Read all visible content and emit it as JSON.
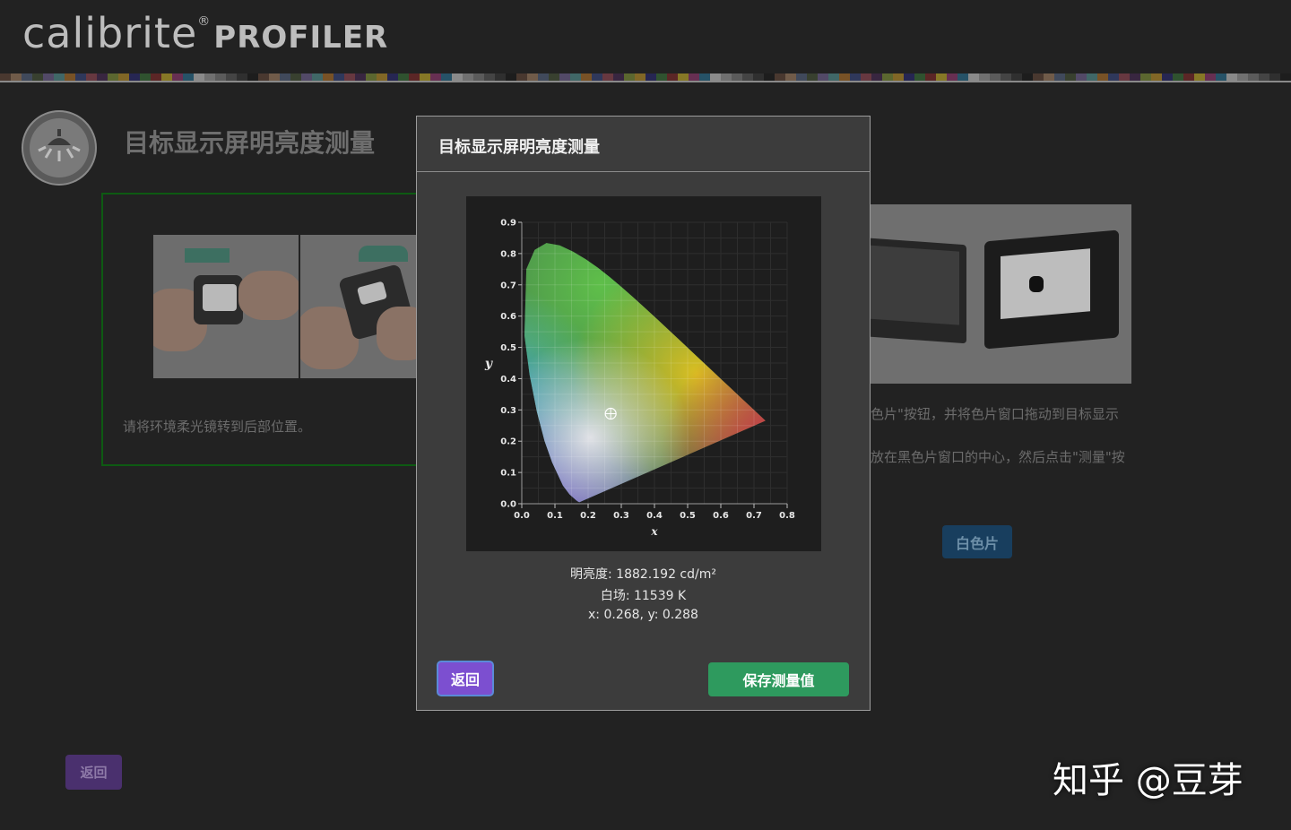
{
  "header": {
    "brand": "calibrite",
    "registered_mark": "®",
    "product": "PROFILER"
  },
  "page": {
    "title": "目标显示屏明亮度测量",
    "left_step_caption": "请将环境柔光镜转到后部位置。",
    "right_step_text_1": "色片\"按钮，并将色片窗口拖动到目标显示",
    "right_step_text_2": "放在黑色片窗口的中心，然后点击\"测量\"按",
    "white_patch_button": "白色片",
    "back_button": "返回"
  },
  "modal": {
    "title": "目标显示屏明亮度测量",
    "luminance": "明亮度: 1882.192 cd/m²",
    "white_point": "白场: 11539 K",
    "xy": "x: 0.268, y: 0.288",
    "back_button": "返回",
    "save_button": "保存测量值"
  },
  "chart_data": {
    "type": "scatter",
    "title": "",
    "xlabel": "x",
    "ylabel": "y",
    "xlim": [
      0.0,
      0.8
    ],
    "ylim": [
      0.0,
      0.9
    ],
    "xticks": [
      "0.0",
      "0.1",
      "0.2",
      "0.3",
      "0.4",
      "0.5",
      "0.6",
      "0.7",
      "0.8"
    ],
    "yticks": [
      "0.0",
      "0.1",
      "0.2",
      "0.3",
      "0.4",
      "0.5",
      "0.6",
      "0.7",
      "0.8",
      "0.9"
    ],
    "grid": true,
    "points": [
      {
        "x": 0.268,
        "y": 0.288
      }
    ],
    "locus": [
      [
        0.1741,
        0.005
      ],
      [
        0.1738,
        0.0049
      ],
      [
        0.1712,
        0.0058
      ],
      [
        0.1644,
        0.0109
      ],
      [
        0.144,
        0.0297
      ],
      [
        0.1241,
        0.0578
      ],
      [
        0.0913,
        0.1327
      ],
      [
        0.0687,
        0.2007
      ],
      [
        0.0454,
        0.295
      ],
      [
        0.0235,
        0.4127
      ],
      [
        0.0082,
        0.5384
      ],
      [
        0.0139,
        0.7502
      ],
      [
        0.0389,
        0.812
      ],
      [
        0.0743,
        0.8338
      ],
      [
        0.1142,
        0.8262
      ],
      [
        0.1547,
        0.8059
      ],
      [
        0.1929,
        0.7816
      ],
      [
        0.2296,
        0.7543
      ],
      [
        0.2658,
        0.7243
      ],
      [
        0.3016,
        0.6923
      ],
      [
        0.3373,
        0.6589
      ],
      [
        0.3731,
        0.6245
      ],
      [
        0.4087,
        0.5896
      ],
      [
        0.4441,
        0.5547
      ],
      [
        0.4788,
        0.5202
      ],
      [
        0.5125,
        0.4866
      ],
      [
        0.5448,
        0.4544
      ],
      [
        0.5752,
        0.4242
      ],
      [
        0.6029,
        0.3965
      ],
      [
        0.627,
        0.3725
      ],
      [
        0.6482,
        0.3514
      ],
      [
        0.6658,
        0.334
      ],
      [
        0.6915,
        0.3083
      ],
      [
        0.7347,
        0.2653
      ]
    ]
  },
  "colors": {
    "background": "#222222",
    "modal_background": "#3c3c3c",
    "back_button": "#7c4fd0",
    "save_button": "#2e9a5e",
    "white_patch_button": "#183e5e",
    "left_card_border": "#0d5a12"
  },
  "watermark": "知乎 @豆芽"
}
